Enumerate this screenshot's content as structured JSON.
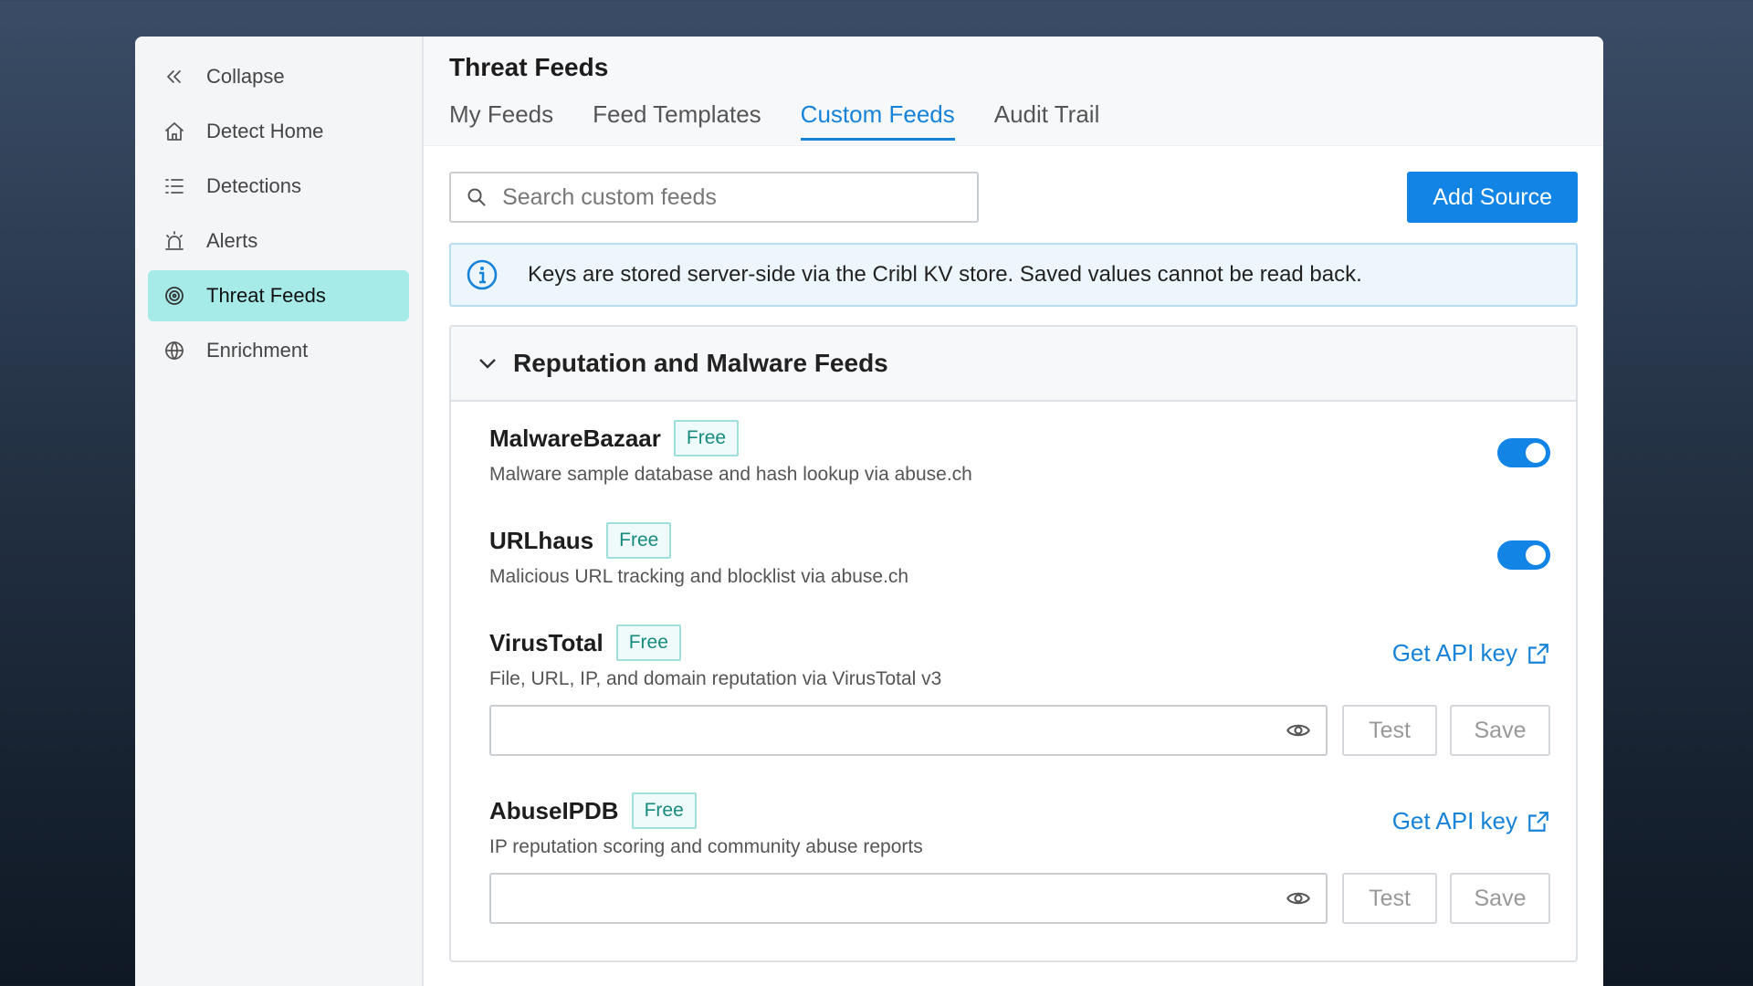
{
  "sidebar": {
    "items": [
      {
        "label": "Collapse",
        "icon": "chevrons-left-icon"
      },
      {
        "label": "Detect Home",
        "icon": "home-icon"
      },
      {
        "label": "Detections",
        "icon": "list-icon"
      },
      {
        "label": "Alerts",
        "icon": "alarm-icon"
      },
      {
        "label": "Threat Feeds",
        "icon": "target-icon",
        "active": true
      },
      {
        "label": "Enrichment",
        "icon": "globe-icon"
      }
    ]
  },
  "header": {
    "title": "Threat Feeds",
    "tabs": [
      {
        "label": "My Feeds"
      },
      {
        "label": "Feed Templates"
      },
      {
        "label": "Custom Feeds",
        "active": true
      },
      {
        "label": "Audit Trail"
      }
    ]
  },
  "toolbar": {
    "search_placeholder": "Search custom feeds",
    "add_label": "Add Source"
  },
  "banner": {
    "text": "Keys are stored server-side via the Cribl KV store. Saved values cannot be read back."
  },
  "section": {
    "title": "Reputation and Malware Feeds",
    "feeds": [
      {
        "name": "MalwareBazaar",
        "badge": "Free",
        "desc": "Malware sample database and hash lookup via abuse.ch",
        "enabled": true
      },
      {
        "name": "URLhaus",
        "badge": "Free",
        "desc": "Malicious URL tracking and blocklist via abuse.ch",
        "enabled": true
      },
      {
        "name": "VirusTotal",
        "badge": "Free",
        "desc": "File, URL, IP, and domain reputation via VirusTotal v3",
        "link": "Get API key",
        "test": "Test",
        "save": "Save"
      },
      {
        "name": "AbuseIPDB",
        "badge": "Free",
        "desc": "IP reputation scoring and community abuse reports",
        "link": "Get API key",
        "test": "Test",
        "save": "Save"
      }
    ]
  },
  "colors": {
    "accent": "#1184e6",
    "active_nav": "#a6ebe8",
    "badge_text": "#178a7e"
  }
}
